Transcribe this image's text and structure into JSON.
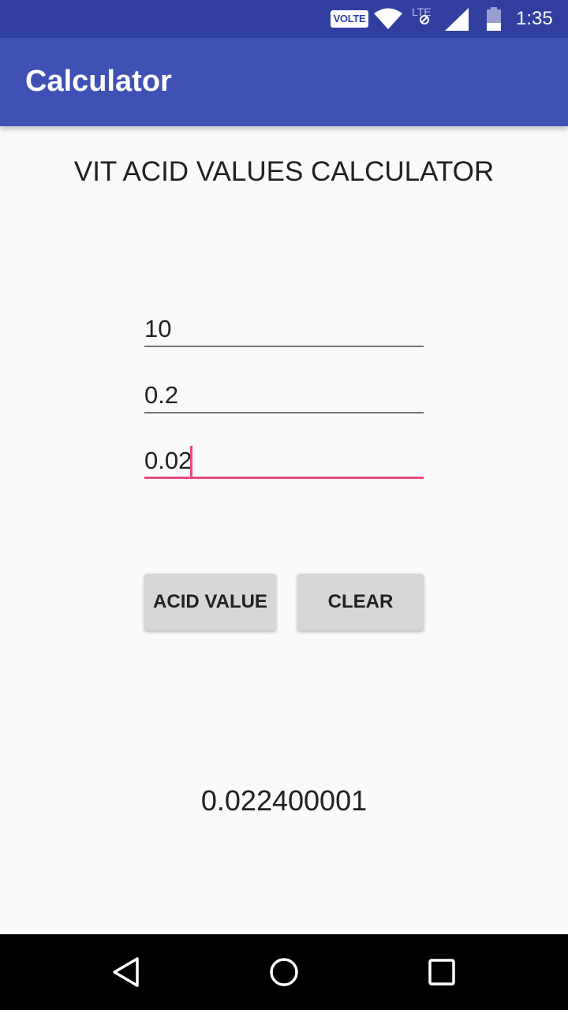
{
  "status_bar": {
    "volte": "VOLTE",
    "network": "LTE",
    "time": "1:35",
    "icons": [
      "wifi-icon",
      "lte-icon",
      "signal-icon",
      "battery-icon"
    ]
  },
  "app_bar": {
    "title": "Calculator"
  },
  "main": {
    "heading": "VIT ACID VALUES CALCULATOR",
    "inputs": [
      {
        "value": "10"
      },
      {
        "value": "0.2"
      },
      {
        "value": "0.02",
        "focused": true
      }
    ],
    "buttons": {
      "acid_value": "ACID VALUE",
      "clear": "CLEAR"
    },
    "result": "0.022400001"
  },
  "nav_bar": {
    "icons": [
      "back-icon",
      "home-icon",
      "recents-icon"
    ]
  },
  "colors": {
    "status_bar": "#303f9f",
    "app_bar": "#3f51b5",
    "accent": "#e84a86",
    "button": "#d6d7d7"
  }
}
